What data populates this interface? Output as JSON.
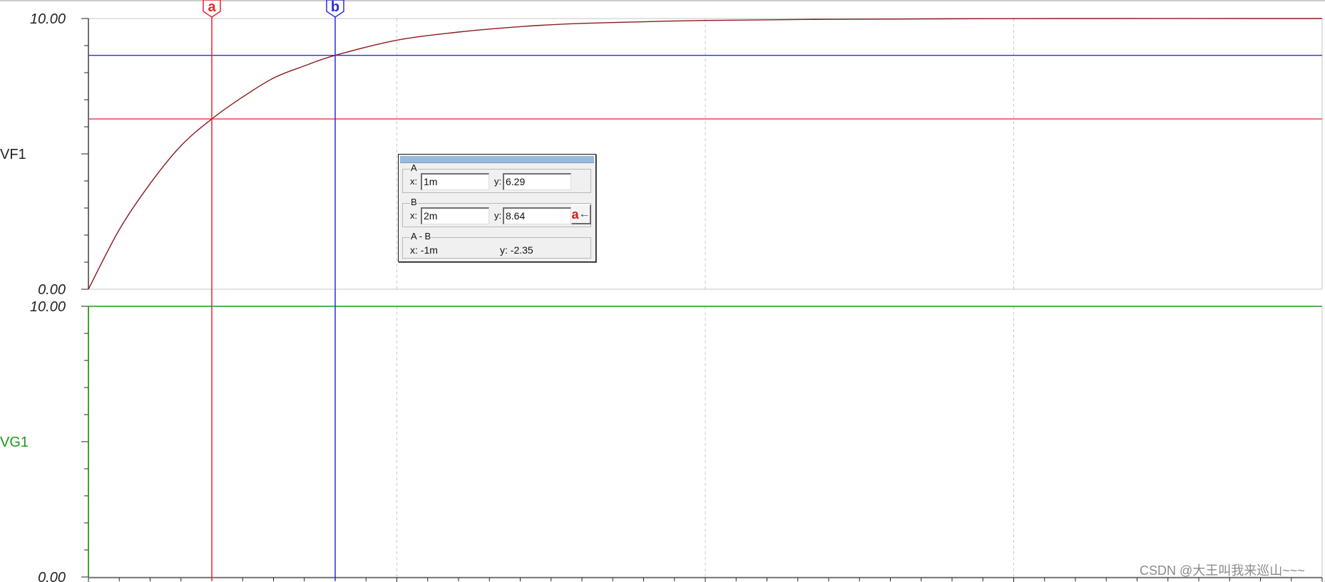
{
  "chart_data": [
    {
      "type": "line",
      "trace_name": "VF1",
      "ylim": [
        0,
        10
      ],
      "ytick_labels": [
        "10.00",
        "0.00"
      ],
      "xlim": [
        0,
        10
      ],
      "x_tick_value_labels": [],
      "x_major_grid": [
        2.5,
        5,
        7.5
      ],
      "grid": true,
      "series": [
        {
          "name": "VF1",
          "color": "#8b1a1a",
          "x": [
            0,
            0.25,
            0.5,
            0.75,
            1,
            1.25,
            1.5,
            1.75,
            2,
            2.5,
            3,
            3.5,
            4,
            5,
            6,
            7,
            8,
            10
          ],
          "y": [
            0,
            2.2,
            3.9,
            5.3,
            6.29,
            7.1,
            7.8,
            8.25,
            8.64,
            9.2,
            9.5,
            9.7,
            9.82,
            9.93,
            9.97,
            9.99,
            10.0,
            10.0
          ]
        }
      ]
    },
    {
      "type": "line",
      "trace_name": "VG1",
      "ylim": [
        0,
        10
      ],
      "ytick_labels": [
        "10.00",
        "0.00"
      ],
      "xlim": [
        0,
        10
      ],
      "x_tick_value_labels": [],
      "grid": true,
      "series": [
        {
          "name": "VG1",
          "color": "#1a9a1a",
          "x": [
            0,
            0,
            10
          ],
          "y": [
            0,
            10,
            10
          ]
        }
      ]
    }
  ],
  "cursors": {
    "a": {
      "label": "a",
      "color": "#e8242a",
      "x": 1,
      "y": 6.29
    },
    "b": {
      "label": "b",
      "color": "#2d2ddc",
      "x": 2,
      "y": 8.64
    }
  },
  "readout": {
    "group_a": {
      "legend": "A",
      "x_tag": "x:",
      "x_value": "1m",
      "y_tag": "y:",
      "y_value": "6.29"
    },
    "group_b": {
      "legend": "B",
      "x_tag": "x:",
      "x_value": "2m",
      "y_tag": "y:",
      "y_value": "8.64"
    },
    "group_diff": {
      "legend": "A - B",
      "x_text": "x:  -1m",
      "y_text": "y: -2.35"
    },
    "swap_button": {
      "letter": "a",
      "arrow": "←",
      "icon": "swap-cursor-icon"
    }
  },
  "watermark": "CSDN @大王叫我来巡山~~~"
}
